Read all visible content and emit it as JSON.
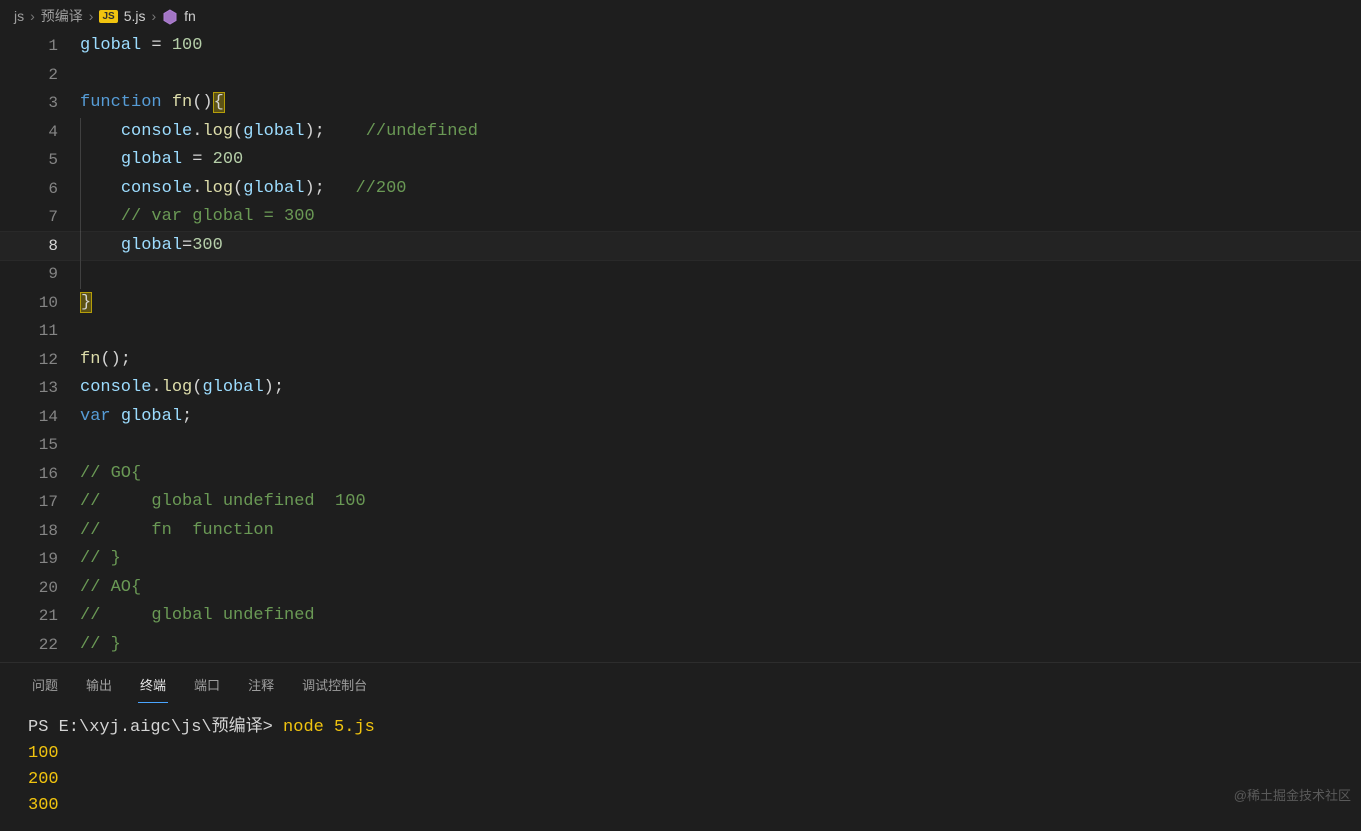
{
  "breadcrumbs": {
    "root": "js",
    "folder": "预编译",
    "file": "5.js",
    "symbol": "fn"
  },
  "code": {
    "lines": [
      {
        "n": 1,
        "tokens": [
          [
            "var",
            "global"
          ],
          [
            "pun",
            " = "
          ],
          [
            "num",
            "100"
          ]
        ]
      },
      {
        "n": 2,
        "tokens": []
      },
      {
        "n": 3,
        "tokens": [
          [
            "kw",
            "function "
          ],
          [
            "fn",
            "fn"
          ],
          [
            "pun",
            "()"
          ],
          [
            "yb",
            "{"
          ]
        ]
      },
      {
        "n": 4,
        "indent": 1,
        "tokens": [
          [
            "pun",
            "    "
          ],
          [
            "var",
            "console"
          ],
          [
            "pun",
            "."
          ],
          [
            "fn",
            "log"
          ],
          [
            "pun",
            "("
          ],
          [
            "var",
            "global"
          ],
          [
            "pun",
            ");    "
          ],
          [
            "cmt",
            "//undefined"
          ]
        ]
      },
      {
        "n": 5,
        "indent": 1,
        "tokens": [
          [
            "pun",
            "    "
          ],
          [
            "var",
            "global"
          ],
          [
            "pun",
            " = "
          ],
          [
            "num",
            "200"
          ]
        ]
      },
      {
        "n": 6,
        "indent": 1,
        "tokens": [
          [
            "pun",
            "    "
          ],
          [
            "var",
            "console"
          ],
          [
            "pun",
            "."
          ],
          [
            "fn",
            "log"
          ],
          [
            "pun",
            "("
          ],
          [
            "var",
            "global"
          ],
          [
            "pun",
            ");   "
          ],
          [
            "cmt",
            "//200"
          ]
        ]
      },
      {
        "n": 7,
        "indent": 1,
        "tokens": [
          [
            "pun",
            "    "
          ],
          [
            "cmt",
            "// var global = 300"
          ]
        ]
      },
      {
        "n": 8,
        "indent": 1,
        "current": true,
        "tokens": [
          [
            "pun",
            "    "
          ],
          [
            "var",
            "global"
          ],
          [
            "pun",
            "="
          ],
          [
            "num",
            "300"
          ]
        ]
      },
      {
        "n": 9,
        "indent": 1,
        "tokens": []
      },
      {
        "n": 10,
        "tokens": [
          [
            "yb",
            "}"
          ]
        ]
      },
      {
        "n": 11,
        "tokens": []
      },
      {
        "n": 12,
        "tokens": [
          [
            "fn",
            "fn"
          ],
          [
            "pun",
            "();"
          ]
        ]
      },
      {
        "n": 13,
        "tokens": [
          [
            "var",
            "console"
          ],
          [
            "pun",
            "."
          ],
          [
            "fn",
            "log"
          ],
          [
            "pun",
            "("
          ],
          [
            "var",
            "global"
          ],
          [
            "pun",
            ");"
          ]
        ]
      },
      {
        "n": 14,
        "tokens": [
          [
            "kw",
            "var "
          ],
          [
            "var",
            "global"
          ],
          [
            "pun",
            ";"
          ]
        ]
      },
      {
        "n": 15,
        "tokens": []
      },
      {
        "n": 16,
        "tokens": [
          [
            "cmt",
            "// GO{"
          ]
        ]
      },
      {
        "n": 17,
        "tokens": [
          [
            "cmt",
            "//     global undefined  100"
          ]
        ]
      },
      {
        "n": 18,
        "tokens": [
          [
            "cmt",
            "//     fn  function"
          ]
        ]
      },
      {
        "n": 19,
        "tokens": [
          [
            "cmt",
            "// }"
          ]
        ]
      },
      {
        "n": 20,
        "tokens": [
          [
            "cmt",
            "// AO{"
          ]
        ]
      },
      {
        "n": 21,
        "tokens": [
          [
            "cmt",
            "//     global undefined"
          ]
        ]
      },
      {
        "n": 22,
        "tokens": [
          [
            "cmt",
            "// }"
          ]
        ]
      }
    ]
  },
  "panel": {
    "tabs": [
      "问题",
      "输出",
      "终端",
      "端口",
      "注释",
      "调试控制台"
    ],
    "active": "终端"
  },
  "terminal": {
    "prompt_prefix": "PS ",
    "cwd": "E:\\xyj.aigc\\js\\预编译",
    "command": "node 5.js",
    "output": [
      "100",
      "200",
      "300"
    ]
  },
  "watermark": "@稀土掘金技术社区"
}
